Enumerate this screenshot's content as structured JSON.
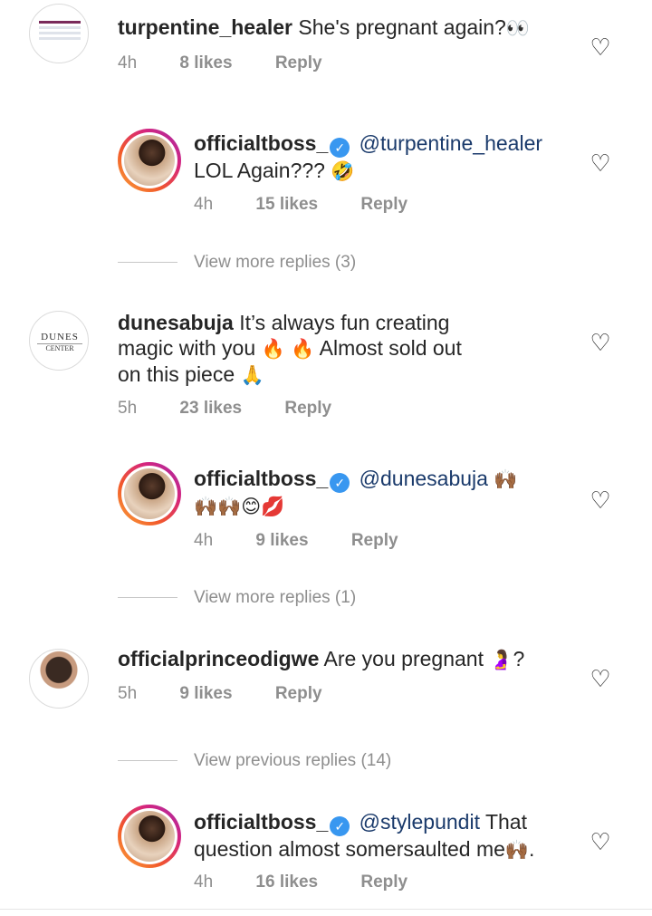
{
  "comments": [
    {
      "username": "turpentine_healer",
      "text": "She's pregnant again?",
      "emoji": "👀",
      "time": "4h",
      "likes": "8 likes",
      "reply": "Reply"
    },
    {
      "username": "officialtboss_",
      "mention": "@turpentine_healer",
      "text": "LOL Again???",
      "emoji": "🤣",
      "time": "4h",
      "likes": "15 likes",
      "reply": "Reply"
    },
    {
      "username": "dunesabuja",
      "text_1": "It’s always fun creating",
      "text_2": "magic with you",
      "emoji_fire": "🔥 🔥",
      "text_3": "Almost sold out",
      "text_4": "on this piece",
      "emoji_pray": "🙏",
      "time": "5h",
      "likes": "23 likes",
      "reply": "Reply",
      "logo_line_1": "DUNES",
      "logo_line_2": "CENTER"
    },
    {
      "username": "officialtboss_",
      "mention": "@dunesabuja",
      "emoji_1": "🙌🏾",
      "emoji_2": "🙌🏾🙌🏾😊💋",
      "time": "4h",
      "likes": "9 likes",
      "reply": "Reply"
    },
    {
      "username": "officialprinceodigwe",
      "text": "Are you pregnant",
      "emoji": "🤰",
      "tail": "?",
      "time": "5h",
      "likes": "9 likes",
      "reply": "Reply"
    },
    {
      "username": "officialtboss_",
      "mention": "@stylepundit",
      "text_1": "That",
      "text_2": "question almost somersaulted me",
      "emoji": "🙌🏾",
      "tail": ".",
      "time": "4h",
      "likes": "16 likes",
      "reply": "Reply"
    }
  ],
  "view_more_1": "View more replies (3)",
  "view_more_2": "View more replies (1)",
  "view_previous": "View previous replies (14)",
  "verified_mark": "✓",
  "heart_glyph": "♡",
  "icons": [
    "heart-icon",
    "verified-badge-icon"
  ],
  "colors": {
    "link": "#1a3a6b",
    "meta": "#8e8e8e",
    "verified": "#3897f0"
  }
}
